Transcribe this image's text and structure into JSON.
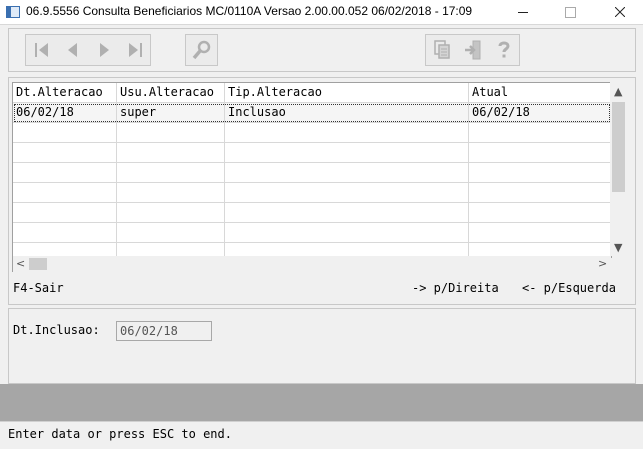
{
  "window": {
    "title": "06.9.5556 Consulta  Beneficiarios MC/0110A Versao 2.00.00.052 06/02/2018 - 17:09"
  },
  "toolbar": {
    "nav_buttons": [
      "first-record-icon",
      "previous-record-icon",
      "next-record-icon",
      "last-record-icon"
    ],
    "search_button": "zoom-search-icon",
    "right_buttons": [
      "copy-icon",
      "exit-door-icon",
      "help-question-icon"
    ]
  },
  "grid": {
    "columns": [
      "Dt.Alteracao",
      "Usu.Alteracao",
      "Tip.Alteracao",
      "Atual"
    ],
    "rows": [
      [
        "06/02/18",
        "super",
        "Inclusao",
        "06/02/18"
      ]
    ]
  },
  "hints": {
    "exit": "F4-Sair",
    "right": "-> p/Direita",
    "left": "<- p/Esquerda"
  },
  "detail": {
    "label": "Dt.Inclusao:",
    "value": "06/02/18"
  },
  "status": {
    "message": "Enter data or press ESC to end."
  }
}
